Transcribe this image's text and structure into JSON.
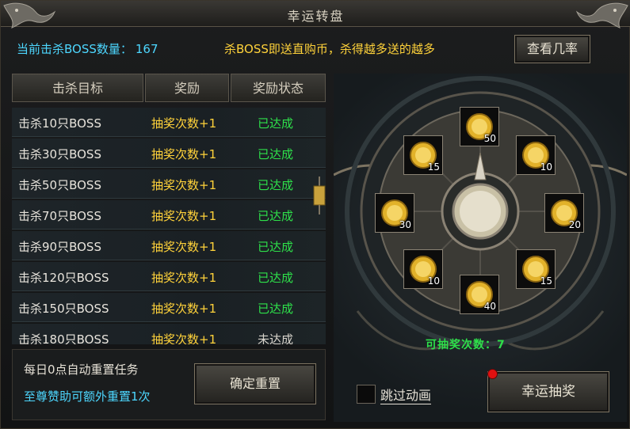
{
  "window": {
    "title": "幸运转盘"
  },
  "header": {
    "kill_count_label": "当前击杀BOSS数量：",
    "kill_count_value": "167",
    "promo_text": "杀BOSS即送直购币，杀得越多送的越多",
    "view_rates_label": "查看几率"
  },
  "table": {
    "columns": [
      "击杀目标",
      "奖励",
      "奖励状态"
    ],
    "rows": [
      {
        "target": "击杀10只BOSS",
        "reward": "抽奖次数+1",
        "status": "已达成",
        "achieved": true
      },
      {
        "target": "击杀30只BOSS",
        "reward": "抽奖次数+1",
        "status": "已达成",
        "achieved": true
      },
      {
        "target": "击杀50只BOSS",
        "reward": "抽奖次数+1",
        "status": "已达成",
        "achieved": true
      },
      {
        "target": "击杀70只BOSS",
        "reward": "抽奖次数+1",
        "status": "已达成",
        "achieved": true
      },
      {
        "target": "击杀90只BOSS",
        "reward": "抽奖次数+1",
        "status": "已达成",
        "achieved": true
      },
      {
        "target": "击杀120只BOSS",
        "reward": "抽奖次数+1",
        "status": "已达成",
        "achieved": true
      },
      {
        "target": "击杀150只BOSS",
        "reward": "抽奖次数+1",
        "status": "已达成",
        "achieved": true
      },
      {
        "target": "击杀180只BOSS",
        "reward": "抽奖次数+1",
        "status": "未达成",
        "achieved": false
      }
    ]
  },
  "reset": {
    "note": "每日0点自动重置任务",
    "sponsor_note": "至尊赞助可额外重置1次",
    "button_label": "确定重置"
  },
  "wheel": {
    "rewards": [
      "50",
      "10",
      "20",
      "15",
      "40",
      "10",
      "30",
      "15"
    ],
    "draws_label": "可抽奖次数：",
    "draws_value": "7",
    "skip_animation_label": "跳过动画",
    "draw_button_label": "幸运抽奖"
  },
  "colors": {
    "cyan": "#4dd7ff",
    "gold": "#ffd23a",
    "green": "#2ee04a",
    "red": "#e01010"
  },
  "icons": [
    "dragon-ornament-icon",
    "gold-coin-icon",
    "pointer-icon",
    "lantern-icon"
  ]
}
